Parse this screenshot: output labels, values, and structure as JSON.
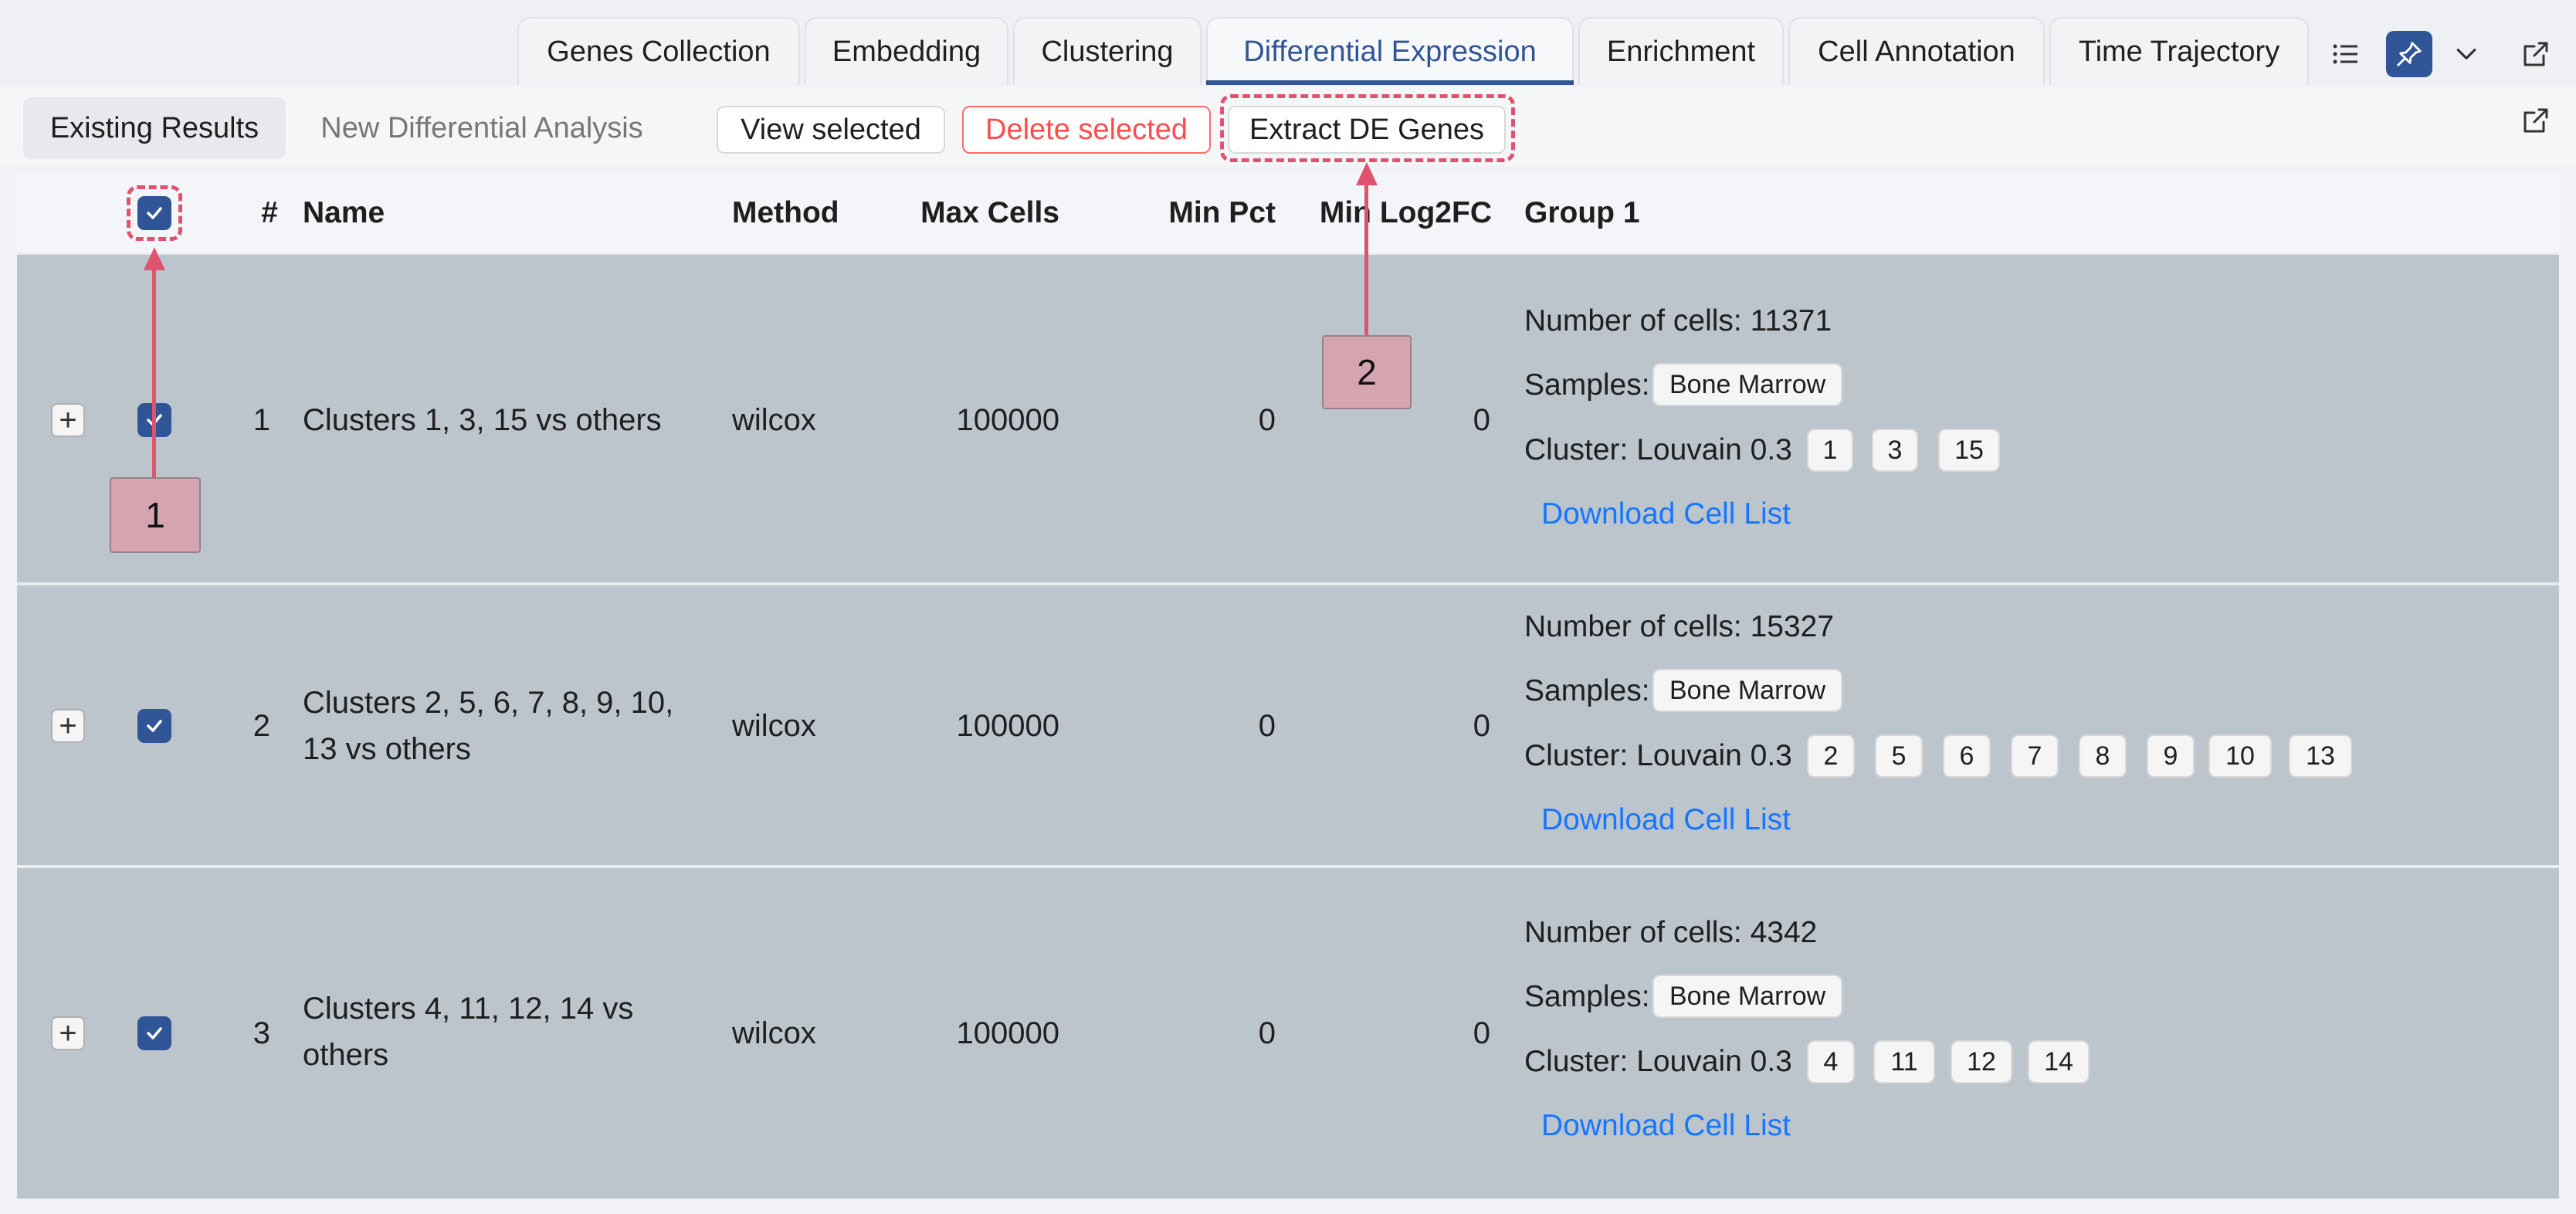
{
  "tabs": [
    {
      "label": "Genes Collection",
      "active": false
    },
    {
      "label": "Embedding",
      "active": false
    },
    {
      "label": "Clustering",
      "active": false
    },
    {
      "label": "Differential Expression",
      "active": true
    },
    {
      "label": "Enrichment",
      "active": false
    },
    {
      "label": "Cell Annotation",
      "active": false
    },
    {
      "label": "Time Trajectory",
      "active": false
    }
  ],
  "tab_icons": [
    "list-icon",
    "pin-icon",
    "chevron-down-icon",
    "external-link-icon"
  ],
  "toolbar": {
    "existing_results": "Existing Results",
    "new_analysis": "New Differential Analysis",
    "view_selected": "View selected",
    "delete_selected": "Delete selected",
    "extract_de_genes": "Extract DE Genes"
  },
  "table": {
    "headers": {
      "index": "#",
      "name": "Name",
      "method": "Method",
      "max_cells": "Max Cells",
      "min_pct": "Min Pct",
      "min_log2fc": "Min Log2FC",
      "group1": "Group 1"
    },
    "rows": [
      {
        "index": "1",
        "name": "Clusters 1, 3, 15 vs others",
        "method": "wilcox",
        "max_cells": "100000",
        "min_pct": "0",
        "min_log2fc": "0",
        "cells_label": "Number of cells: 11371",
        "samples_label": "Samples:",
        "samples": [
          "Bone Marrow"
        ],
        "cluster_label": "Cluster: Louvain 0.3",
        "clusters": [
          "1",
          "3",
          "15"
        ],
        "download": "Download Cell List"
      },
      {
        "index": "2",
        "name": "Clusters 2, 5, 6, 7, 8, 9, 10, 13 vs others",
        "method": "wilcox",
        "max_cells": "100000",
        "min_pct": "0",
        "min_log2fc": "0",
        "cells_label": "Number of cells: 15327",
        "samples_label": "Samples:",
        "samples": [
          "Bone Marrow"
        ],
        "cluster_label": "Cluster: Louvain 0.3",
        "clusters": [
          "2",
          "5",
          "6",
          "7",
          "8",
          "9",
          "10",
          "13"
        ],
        "download": "Download Cell List"
      },
      {
        "index": "3",
        "name": "Clusters 4, 11, 12, 14 vs others",
        "method": "wilcox",
        "max_cells": "100000",
        "min_pct": "0",
        "min_log2fc": "0",
        "cells_label": "Number of cells: 4342",
        "samples_label": "Samples:",
        "samples": [
          "Bone Marrow"
        ],
        "cluster_label": "Cluster: Louvain 0.3",
        "clusters": [
          "4",
          "11",
          "12",
          "14"
        ],
        "download": "Download Cell List"
      }
    ]
  },
  "annotations": {
    "callout1": "1",
    "callout2": "2"
  },
  "colors": {
    "accent": "#2f5597",
    "danger": "#ff4d4f",
    "link": "#1677ff",
    "annotation": "#e0536f",
    "row_bg": "#bcc4cc"
  }
}
